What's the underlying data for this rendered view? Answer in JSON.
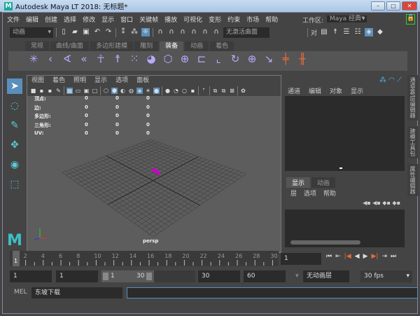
{
  "window": {
    "title": "Autodesk Maya LT 2018: 无标题*",
    "app_icon": "M",
    "minimize": "–",
    "maximize": "□",
    "close": "✕"
  },
  "menu": [
    "文件",
    "编辑",
    "创建",
    "选择",
    "修改",
    "显示",
    "窗口",
    "关键帧",
    "播放",
    "可视化",
    "变形",
    "约束",
    "市场",
    "帮助"
  ],
  "workspace": {
    "label": "工作区:",
    "value": "Maya 经典*"
  },
  "toolbar": {
    "mode": "动画",
    "no_live_surface": "无激活曲面",
    "symmetry": "对"
  },
  "shelf": {
    "tabs": [
      "常规",
      "曲线/曲面",
      "多边形建模",
      "雕刻",
      "装备",
      "动画",
      "着色"
    ],
    "active": 4
  },
  "viewport": {
    "menu": [
      "视图",
      "着色",
      "照明",
      "显示",
      "选项",
      "面板"
    ],
    "camera": "persp",
    "hud": [
      {
        "label": "顶点:",
        "v": [
          "0",
          "0",
          "0"
        ]
      },
      {
        "label": "边:",
        "v": [
          "0",
          "0",
          "0"
        ]
      },
      {
        "label": "多边形:",
        "v": [
          "0",
          "0",
          "0"
        ]
      },
      {
        "label": "三角形:",
        "v": [
          "0",
          "0",
          "0"
        ]
      },
      {
        "label": "UV:",
        "v": [
          "0",
          "0",
          "0"
        ]
      }
    ]
  },
  "channel_box": {
    "menu": [
      "通道",
      "编辑",
      "对象",
      "显示"
    ]
  },
  "layer_editor": {
    "tabs": [
      "显示",
      "动画"
    ],
    "menu": [
      "层",
      "选项",
      "帮助"
    ]
  },
  "side_tabs": [
    "通道盒/层编辑器",
    "建模工具包",
    "属性编辑器"
  ],
  "timeline": {
    "labels": [
      "2",
      "4",
      "6",
      "8",
      "10",
      "12",
      "14",
      "16",
      "18",
      "20",
      "22",
      "24",
      "26",
      "28",
      "30"
    ],
    "current": "1",
    "current_field": "1"
  },
  "range": {
    "start": "1",
    "playback_start": "1",
    "slider_start": "1",
    "slider_end": "30",
    "playback_end": "30",
    "end": "60",
    "anim_layer": "无动画层",
    "fps": "30 fps"
  },
  "command": {
    "lang": "MEL",
    "input": "东坡下载"
  },
  "colors": {
    "accent": "#5a8fbd",
    "object": "#cc00cc"
  }
}
